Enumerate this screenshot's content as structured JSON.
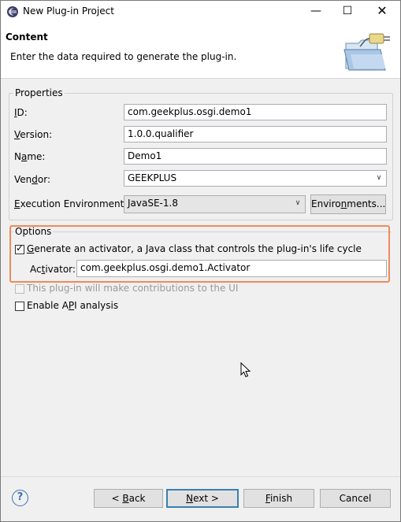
{
  "window": {
    "title": "New Plug-in Project",
    "minimize": "—",
    "maximize": "☐",
    "close": "✕"
  },
  "header": {
    "title": "Content",
    "description": "Enter the data required to generate the plug-in."
  },
  "properties": {
    "group_label": "Properties",
    "id": {
      "label_u": "I",
      "label_rest": "D:",
      "value": "com.geekplus.osgi.demo1"
    },
    "version": {
      "label_u": "V",
      "label_rest": "ersion:",
      "value": "1.0.0.qualifier"
    },
    "name": {
      "label_pre": "N",
      "label_u": "a",
      "label_rest": "me:",
      "value": "Demo1"
    },
    "vendor": {
      "label_pre": "Ven",
      "label_u": "d",
      "label_rest": "or:",
      "value": "GEEKPLUS"
    },
    "execution_environment": {
      "label_u": "E",
      "label_rest": "xecution Environment:",
      "value": "JavaSE-1.8"
    },
    "environments_button": {
      "pre": "Enviro",
      "u": "n",
      "rest": "ments..."
    }
  },
  "options": {
    "group_label": "Options",
    "generate_activator": {
      "checked": true,
      "label_u": "G",
      "label_rest": "enerate an activator, a Java class that controls the plug-in's life cycle"
    },
    "activator": {
      "label_pre": "Ac",
      "label_u": "t",
      "label_rest": "ivator:",
      "value": "com.geekplus.osgi.demo1.Activator"
    },
    "contributions": {
      "checked": false,
      "enabled": false,
      "label": "This plug-in will make contributions to the UI"
    },
    "api_analysis": {
      "checked": false,
      "label_pre": "Enable A",
      "label_u": "P",
      "label_rest": "I analysis"
    }
  },
  "footer": {
    "help": "?",
    "back": {
      "pre": "< ",
      "u": "B",
      "rest": "ack"
    },
    "next": {
      "u": "N",
      "rest": "ext >"
    },
    "finish": {
      "u": "F",
      "rest": "inish"
    },
    "cancel": "Cancel"
  }
}
